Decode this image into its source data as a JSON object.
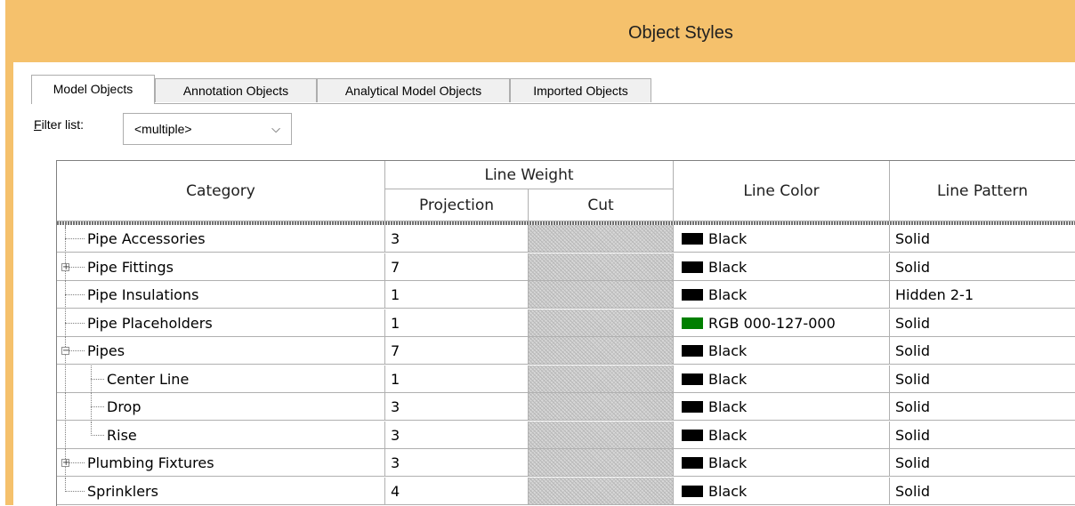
{
  "window": {
    "title": "Object Styles"
  },
  "tabs": [
    {
      "label": "Model Objects",
      "active": true
    },
    {
      "label": "Annotation Objects",
      "active": false
    },
    {
      "label": "Analytical Model Objects",
      "active": false
    },
    {
      "label": "Imported Objects",
      "active": false
    }
  ],
  "filter": {
    "label_accel": "F",
    "label_rest": "ilter list:",
    "value": "<multiple>"
  },
  "table": {
    "headers": {
      "category": "Category",
      "line_weight": "Line Weight",
      "projection": "Projection",
      "cut": "Cut",
      "line_color": "Line Color",
      "line_pattern": "Line Pattern"
    },
    "rows": [
      {
        "category": "Pipe Accessories",
        "projection": "3",
        "color_name": "Black",
        "color_hex": "#000000",
        "pattern": "Solid",
        "level": 0,
        "expander": "none"
      },
      {
        "category": "Pipe Fittings",
        "projection": "7",
        "color_name": "Black",
        "color_hex": "#000000",
        "pattern": "Solid",
        "level": 0,
        "expander": "plus"
      },
      {
        "category": "Pipe Insulations",
        "projection": "1",
        "color_name": "Black",
        "color_hex": "#000000",
        "pattern": "Hidden 2-1",
        "level": 0,
        "expander": "none"
      },
      {
        "category": "Pipe Placeholders",
        "projection": "1",
        "color_name": "RGB 000-127-000",
        "color_hex": "#007f00",
        "pattern": "Solid",
        "level": 0,
        "expander": "none"
      },
      {
        "category": "Pipes",
        "projection": "7",
        "color_name": "Black",
        "color_hex": "#000000",
        "pattern": "Solid",
        "level": 0,
        "expander": "minus"
      },
      {
        "category": "Center Line",
        "projection": "1",
        "color_name": "Black",
        "color_hex": "#000000",
        "pattern": "Solid",
        "level": 1,
        "expander": "none"
      },
      {
        "category": "Drop",
        "projection": "3",
        "color_name": "Black",
        "color_hex": "#000000",
        "pattern": "Solid",
        "level": 1,
        "expander": "none"
      },
      {
        "category": "Rise",
        "projection": "3",
        "color_name": "Black",
        "color_hex": "#000000",
        "pattern": "Solid",
        "level": 1,
        "expander": "none"
      },
      {
        "category": "Plumbing Fixtures",
        "projection": "3",
        "color_name": "Black",
        "color_hex": "#000000",
        "pattern": "Solid",
        "level": 0,
        "expander": "plus"
      },
      {
        "category": "Sprinklers",
        "projection": "4",
        "color_name": "Black",
        "color_hex": "#000000",
        "pattern": "Solid",
        "level": 0,
        "expander": "none"
      }
    ]
  },
  "colors": {
    "title_bar": "#f5c16c",
    "cut_cell": "#d8d8d8"
  }
}
